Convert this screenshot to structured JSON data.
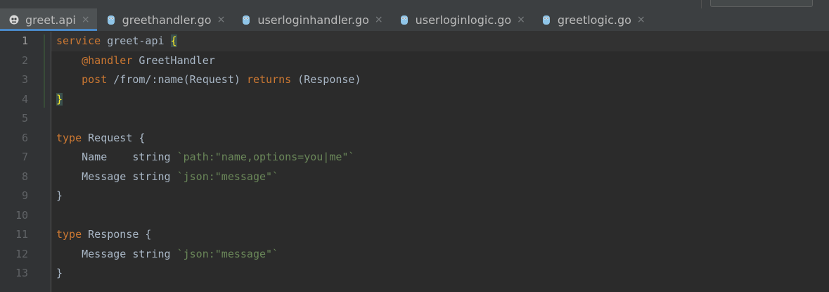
{
  "tabs": [
    {
      "label": "greet.api",
      "icon": "go-zero-api-file-icon",
      "active": true
    },
    {
      "label": "greethandler.go",
      "icon": "go-gopher-file-icon",
      "active": false
    },
    {
      "label": "userloginhandler.go",
      "icon": "go-gopher-file-icon",
      "active": false
    },
    {
      "label": "userloginlogic.go",
      "icon": "go-gopher-file-icon",
      "active": false
    },
    {
      "label": "greetlogic.go",
      "icon": "go-gopher-file-icon",
      "active": false
    }
  ],
  "close_glyph": "×",
  "line_numbers": [
    "1",
    "2",
    "3",
    "4",
    "5",
    "6",
    "7",
    "8",
    "9",
    "10",
    "11",
    "12",
    "13"
  ],
  "code": {
    "l1": {
      "kw": "service",
      "text": " greet-api ",
      "brace": "{"
    },
    "l2": {
      "indent": "    ",
      "kw": "@handler",
      "text": " GreetHandler"
    },
    "l3": {
      "indent": "    ",
      "kw1": "post",
      "text1": " /from/:name(Request) ",
      "kw2": "returns",
      "text2": " (Response)"
    },
    "l4": {
      "brace": "}"
    },
    "l6": {
      "kw": "type",
      "text": " Request {"
    },
    "l7": {
      "text": "    Name    string ",
      "str": "`path:\"name,options=you|me\"`"
    },
    "l8": {
      "text": "    Message string ",
      "str": "`json:\"message\"`"
    },
    "l9": {
      "text": "}"
    },
    "l11": {
      "kw": "type",
      "text": " Response {"
    },
    "l12": {
      "text": "    Message string ",
      "str": "`json:\"message\"`"
    },
    "l13": {
      "text": "}"
    }
  },
  "colors": {
    "background": "#2b2b2b",
    "keyword": "#cc7832",
    "string": "#6a8759",
    "default_text": "#a9b7c6",
    "active_tab_underline": "#4a88c7"
  }
}
